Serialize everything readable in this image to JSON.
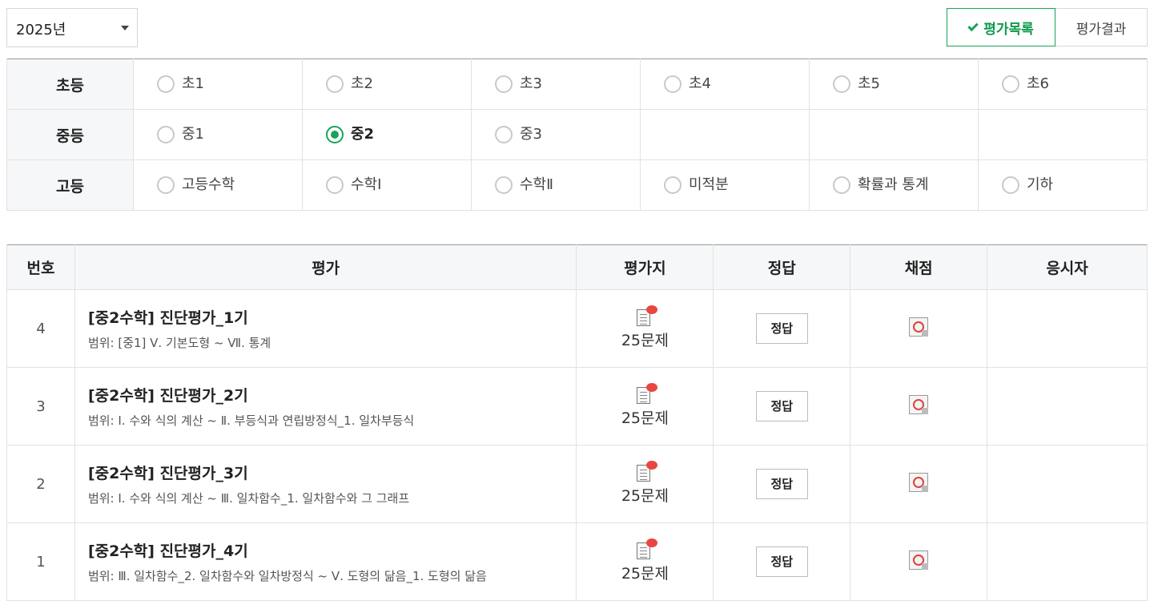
{
  "year_select": {
    "value": "2025년"
  },
  "tabs": [
    {
      "label": "평가목록",
      "active": true
    },
    {
      "label": "평가결과",
      "active": false
    }
  ],
  "grade_filter": {
    "rows": [
      {
        "head": "초등",
        "options": [
          "초1",
          "초2",
          "초3",
          "초4",
          "초5",
          "초6"
        ]
      },
      {
        "head": "중등",
        "options": [
          "중1",
          "중2",
          "중3"
        ]
      },
      {
        "head": "고등",
        "options": [
          "고등수학",
          "수학Ⅰ",
          "수학Ⅱ",
          "미적분",
          "확률과 통계",
          "기하"
        ]
      }
    ],
    "selected": "중2"
  },
  "colors": {
    "accent": "#19a35a",
    "header_bg": "#f5f7f9"
  },
  "list": {
    "headers": [
      "번호",
      "평가",
      "평가지",
      "정답",
      "채점",
      "응시자"
    ],
    "rows": [
      {
        "no": "4",
        "title": "[중2수학] 진단평가_1기",
        "range": "범위: [중1] Ⅴ. 기본도형 ~ Ⅶ. 통계",
        "paper": "25문제",
        "answer_btn": "정답"
      },
      {
        "no": "3",
        "title": "[중2수학] 진단평가_2기",
        "range": "범위: Ⅰ. 수와 식의 계산 ~ Ⅱ. 부등식과 연립방정식_1. 일차부등식",
        "paper": "25문제",
        "answer_btn": "정답"
      },
      {
        "no": "2",
        "title": "[중2수학] 진단평가_3기",
        "range": "범위: Ⅰ. 수와 식의 계산 ~ Ⅲ. 일차함수_1. 일차함수와 그 그래프",
        "paper": "25문제",
        "answer_btn": "정답"
      },
      {
        "no": "1",
        "title": "[중2수학] 진단평가_4기",
        "range": "범위: Ⅲ. 일차함수_2. 일차함수와 일차방정식 ~ Ⅴ. 도형의 닮음_1. 도형의 닮음",
        "paper": "25문제",
        "answer_btn": "정답"
      }
    ]
  }
}
